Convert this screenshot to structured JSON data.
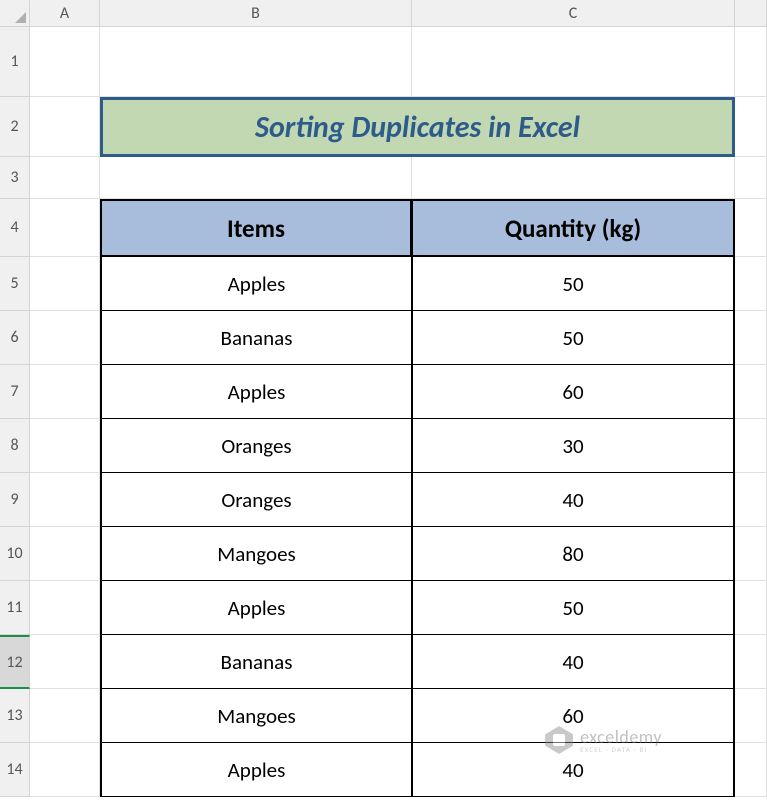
{
  "columns": [
    "A",
    "B",
    "C"
  ],
  "row_heights": {
    "1": 70,
    "2": 60,
    "3": 42,
    "4": 58,
    "default": 54
  },
  "selected_row": 12,
  "title": "Sorting Duplicates in Excel",
  "headers": {
    "items": "Items",
    "quantity": "Quantity (kg)"
  },
  "data": [
    {
      "item": "Apples",
      "qty": "50"
    },
    {
      "item": "Bananas",
      "qty": "50"
    },
    {
      "item": "Apples",
      "qty": "60"
    },
    {
      "item": "Oranges",
      "qty": "30"
    },
    {
      "item": "Oranges",
      "qty": "40"
    },
    {
      "item": "Mangoes",
      "qty": "80"
    },
    {
      "item": "Apples",
      "qty": "50"
    },
    {
      "item": "Bananas",
      "qty": "40"
    },
    {
      "item": "Mangoes",
      "qty": "60"
    },
    {
      "item": "Apples",
      "qty": "40"
    }
  ],
  "watermark": {
    "main": "exceldemy",
    "sub": "EXCEL · DATA · BI"
  }
}
